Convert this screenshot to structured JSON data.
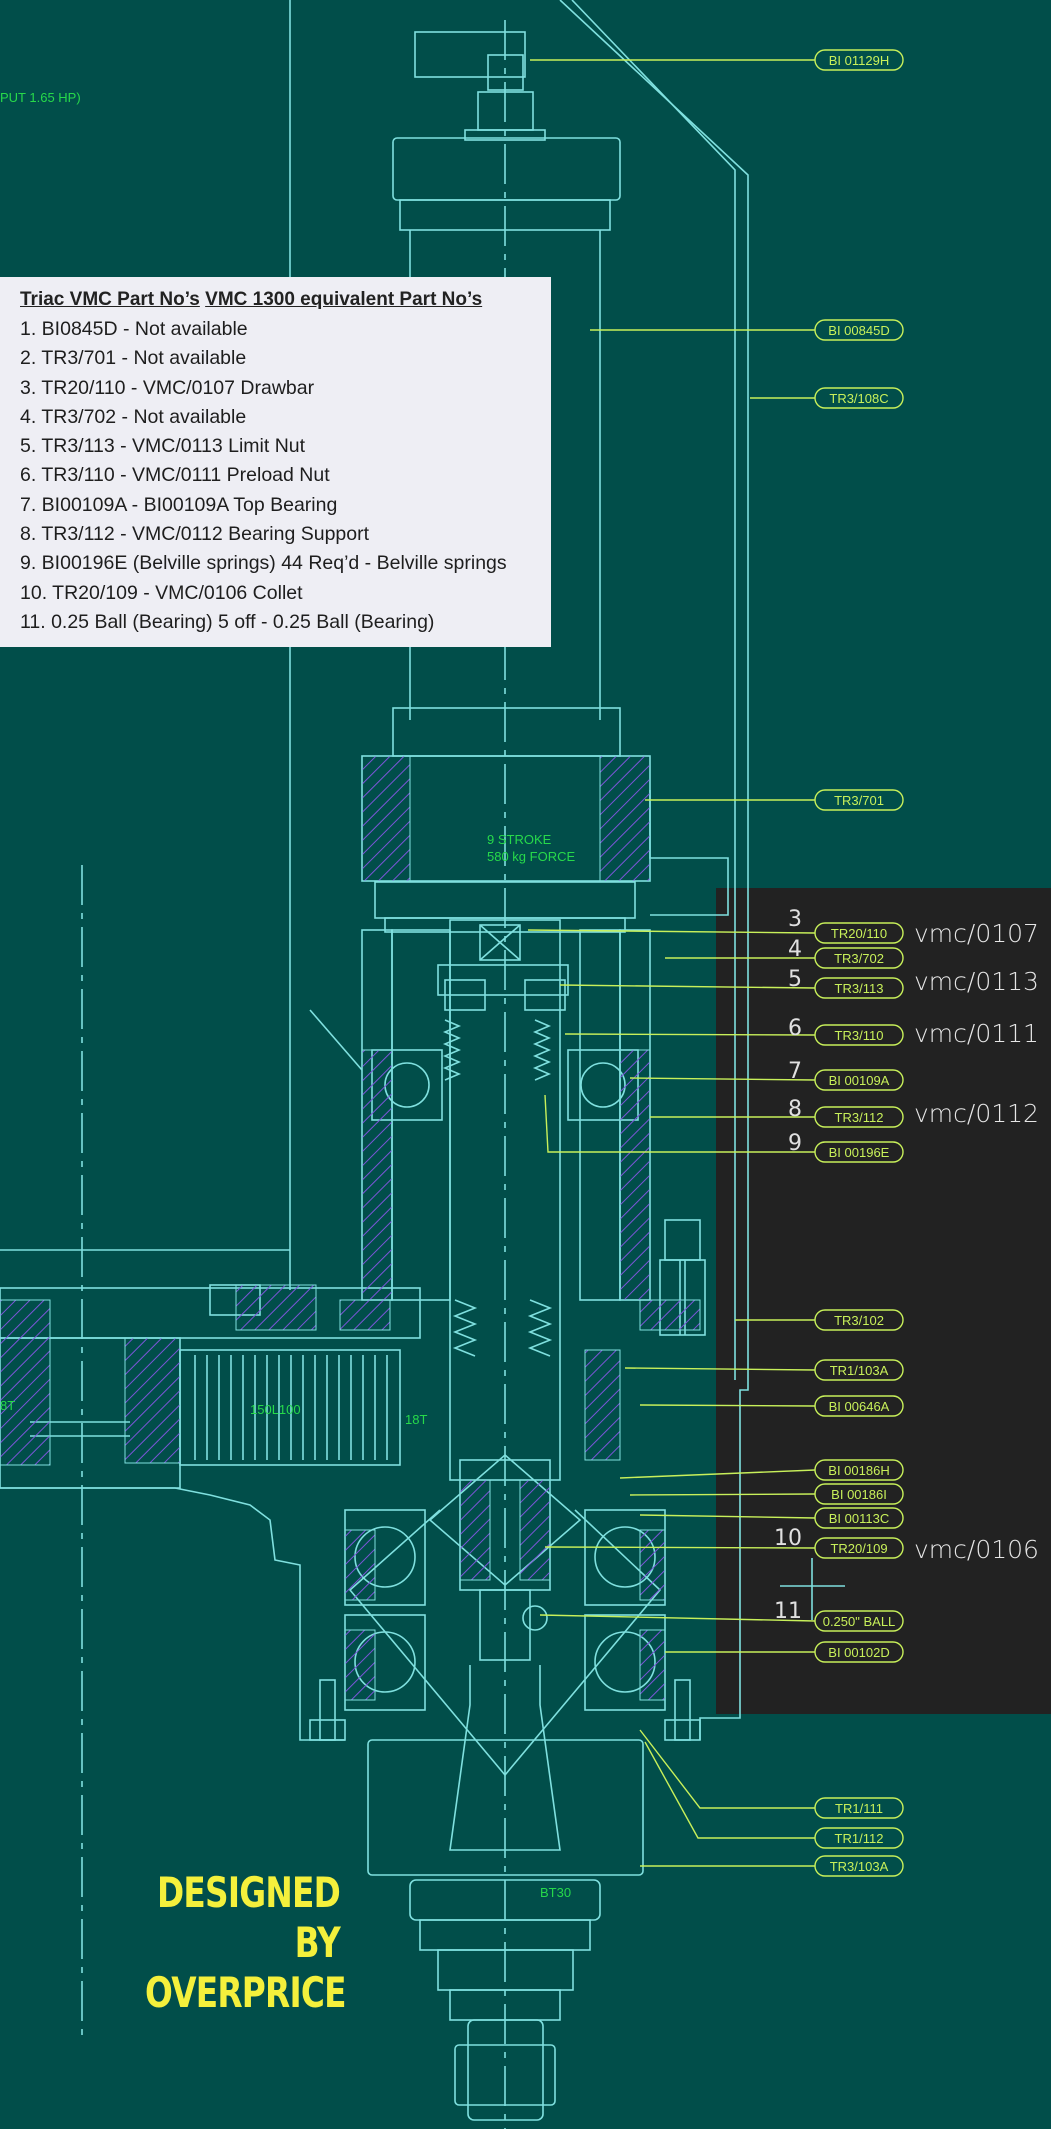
{
  "drawing": {
    "top_left_note": "PUT 1.65 HP)",
    "stroke_note_1": "9 STROKE",
    "stroke_note_2": "580 kg FORCE",
    "gear_label_left": "8T",
    "gear_label": "150L100",
    "gear_label_right": "18T",
    "taper_label": "BT30",
    "colors": {
      "background": "#014e4a",
      "lines": "#7fe0df",
      "tags": "#c8f05a",
      "dark_panel": "#222222"
    }
  },
  "parts_list": {
    "heading_a": "Triac VMC Part No’s",
    "heading_b": "VMC 1300 equivalent Part No’s",
    "items": [
      "1. BI0845D - Not available",
      "2. TR3/701 - Not available",
      "3. TR20/110 - VMC/0107 Drawbar",
      "4. TR3/702 - Not available",
      "5. TR3/113 - VMC/0113 Limit Nut",
      "6. TR3/110 - VMC/0111 Preload Nut",
      "7. BI00109A - BI00109A Top Bearing",
      "8. TR3/112 - VMC/0112 Bearing Support",
      "9. BI00196E (Belville springs) 44 Req’d - Belville springs",
      "10. TR20/109 - VMC/0106 Collet",
      "11. 0.25 Ball (Bearing) 5 off - 0.25 Ball (Bearing)"
    ]
  },
  "tags": [
    "BI 01129H",
    "BI 00845D",
    "TR3/108C",
    "TR3/701",
    "TR20/110",
    "TR3/702",
    "TR3/113",
    "TR3/110",
    "BI 00109A",
    "TR3/112",
    "BI 00196E",
    "TR3/102",
    "TR1/103A",
    "BI 00646A",
    "BI 00186H",
    "BI 00186I",
    "BI 00113C",
    "TR20/109",
    "0.250\" BALL",
    "BI 00102D",
    "TR1/111",
    "TR1/112",
    "TR3/103A"
  ],
  "callouts": {
    "numbers": [
      "3",
      "4",
      "5",
      "6",
      "7",
      "8",
      "9",
      "10",
      "11"
    ],
    "vmc": [
      "vmc/0107",
      "vmc/0113",
      "vmc/0111",
      "vmc/0112",
      "vmc/0106"
    ]
  },
  "watermark": {
    "line1": "DESIGNED BY",
    "line2": "OVERPRICE"
  }
}
